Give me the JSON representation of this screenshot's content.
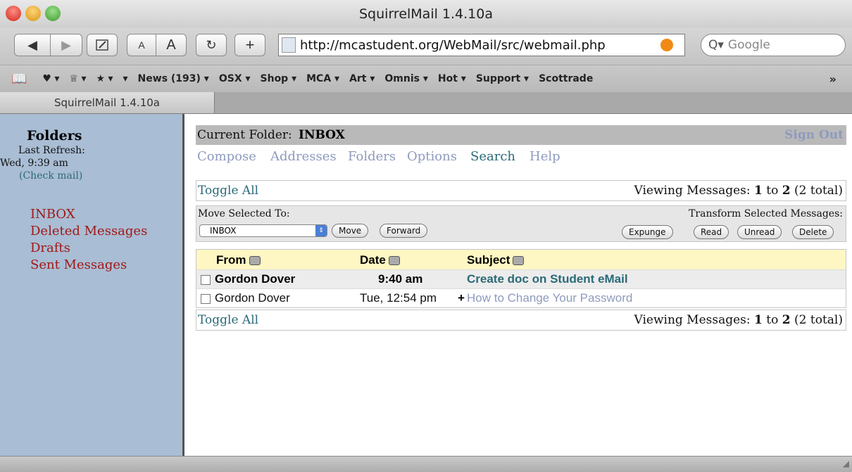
{
  "window": {
    "title": "SquirrelMail 1.4.10a"
  },
  "toolbar": {
    "url": "http://mcastudent.org/WebMail/src/webmail.php",
    "search_placeholder": "Google",
    "font_small": "A",
    "font_large": "A",
    "add": "+"
  },
  "bookmarks": [
    "News (193) ▾",
    "OSX ▾",
    "Shop ▾",
    "MCA ▾",
    "Art ▾",
    "Omnis ▾",
    "Hot ▾",
    "Support ▾",
    "Scottrade"
  ],
  "tab": {
    "label": "SquirrelMail 1.4.10a"
  },
  "sidebar": {
    "heading": "Folders",
    "last_refresh_label": "Last Refresh:",
    "last_refresh_time": "Wed, 9:39 am",
    "check_mail": "(Check mail)",
    "folders": [
      "INBOX",
      "Deleted Messages",
      "Drafts",
      "Sent Messages"
    ]
  },
  "main": {
    "current_folder_label": "Current Folder:",
    "current_folder_name": "INBOX",
    "sign_out": "Sign Out",
    "nav": [
      "Compose",
      "Addresses",
      "Folders",
      "Options",
      "Search",
      "Help"
    ],
    "toggle_all": "Toggle All",
    "viewing_prefix": "Viewing Messages:",
    "viewing_from": "1",
    "viewing_to_word": "to",
    "viewing_to": "2",
    "viewing_total": "(2 total)",
    "move_selected_label": "Move Selected To:",
    "transform_label": "Transform Selected Messages:",
    "folder_select_value": "INBOX",
    "buttons": {
      "move": "Move",
      "forward": "Forward",
      "expunge": "Expunge",
      "read": "Read",
      "unread": "Unread",
      "delete": "Delete"
    },
    "columns": {
      "from": "From",
      "date": "Date",
      "subject": "Subject"
    },
    "messages": [
      {
        "from": "Gordon Dover",
        "date": "9:40 am",
        "flag": "",
        "subject": "Create doc on Student eMail",
        "unread": true
      },
      {
        "from": "Gordon Dover",
        "date": "Tue, 12:54 pm",
        "flag": "+",
        "subject": "How to Change Your Password",
        "unread": false
      }
    ]
  },
  "colors": {
    "sidebar_bg": "#a9bdd4",
    "folder_link": "#a01818",
    "link_blue": "#8e9bbd",
    "header_yellow": "#fff7c3",
    "subject_teal": "#2a6a78"
  }
}
